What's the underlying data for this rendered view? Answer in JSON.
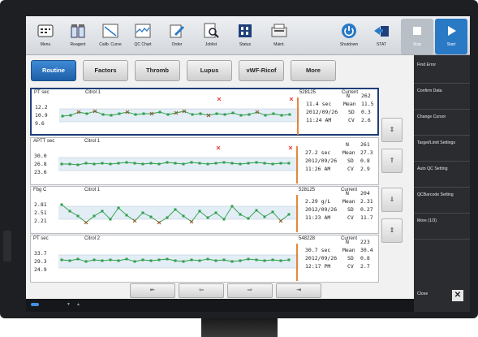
{
  "toolbar": {
    "buttons": [
      {
        "label": "Menu",
        "icon": "menu-icon"
      },
      {
        "label": "Reagent",
        "icon": "reagent-icon"
      },
      {
        "label": "Calib. Curve",
        "icon": "calib-curve-icon"
      },
      {
        "label": "QC Chart",
        "icon": "qc-chart-icon"
      },
      {
        "label": "Order",
        "icon": "order-icon"
      },
      {
        "label": "Joblist",
        "icon": "joblist-icon"
      },
      {
        "label": "Status",
        "icon": "status-icon"
      },
      {
        "label": "Maint.",
        "icon": "maint-icon"
      },
      {
        "label": "Shutdown",
        "icon": "power-icon"
      },
      {
        "label": "STAT",
        "icon": "stat-icon"
      },
      {
        "label": "Stop",
        "icon": "stop-icon"
      },
      {
        "label": "Start",
        "icon": "play-icon"
      }
    ]
  },
  "tabs": [
    {
      "label": "Routine",
      "active": true
    },
    {
      "label": "Factors",
      "active": false
    },
    {
      "label": "Thromb",
      "active": false
    },
    {
      "label": "Lupus",
      "active": false
    },
    {
      "label": "vWF-Ricof",
      "active": false
    },
    {
      "label": "More",
      "active": false
    }
  ],
  "panels": [
    {
      "param": "PT sec",
      "reagent": "Citrol 1",
      "lot": "528125",
      "status": "Current",
      "y_labels": [
        "12.2",
        "10.9",
        "9.6"
      ],
      "value": "11.4 sec",
      "date": "2012/09/26",
      "time": "11:24 AM",
      "N": "262",
      "Mean": "11.5",
      "SD": "0.3",
      "CV": "2.6",
      "selected": true
    },
    {
      "param": "APTT sec",
      "reagent": "Citrol 1",
      "lot": "",
      "y_labels": [
        "30.0",
        "26.8",
        "23.6"
      ],
      "value": "27.2 sec",
      "date": "2012/09/26",
      "time": "11:26 AM",
      "N": "261",
      "Mean": "27.3",
      "SD": "0.8",
      "CV": "2.9",
      "selected": false
    },
    {
      "param": "Fbg C",
      "reagent": "Citrol 1",
      "lot": "528125",
      "status": "Current",
      "y_labels": [
        "2.81",
        "2.51",
        "2.21"
      ],
      "value": "2.29 g/L",
      "date": "2012/09/26",
      "time": "11:23 AM",
      "N": "204",
      "Mean": "2.31",
      "SD": "0.27",
      "CV": "11.7",
      "selected": false
    },
    {
      "param": "PT sec",
      "reagent": "Citrol 2",
      "lot": "548228",
      "status": "Current",
      "y_labels": [
        "33.7",
        "29.3",
        "24.9"
      ],
      "value": "30.7 sec",
      "date": "2012/09/26",
      "time": "12:17 PM",
      "N": "223",
      "Mean": "30.4",
      "SD": "0.8",
      "CV": "2.7",
      "selected": false
    }
  ],
  "stat_labels": {
    "n": "N",
    "mean": "Mean",
    "sd": "SD",
    "cv": "CV"
  },
  "scroll_buttons": [
    "⇕",
    "⇑",
    "⇓",
    "⇕"
  ],
  "bottom_nav": [
    "⇤",
    "⇦",
    "⇨",
    "⇥"
  ],
  "right_menu": [
    "Find Error",
    "Confirm Data",
    "Change Cursor",
    "Target/Limit Settings",
    "Auto QC Setting",
    "QCBarcode Setting",
    "More (1/3)"
  ],
  "right_close": "Close",
  "colors": {
    "accent": "#2a79c5",
    "selected_border": "#1f3f7a",
    "point": "#2e9e4a",
    "flagged": "#8b5a2b",
    "reject": "#e53935",
    "cursor": "#e07b28"
  }
}
